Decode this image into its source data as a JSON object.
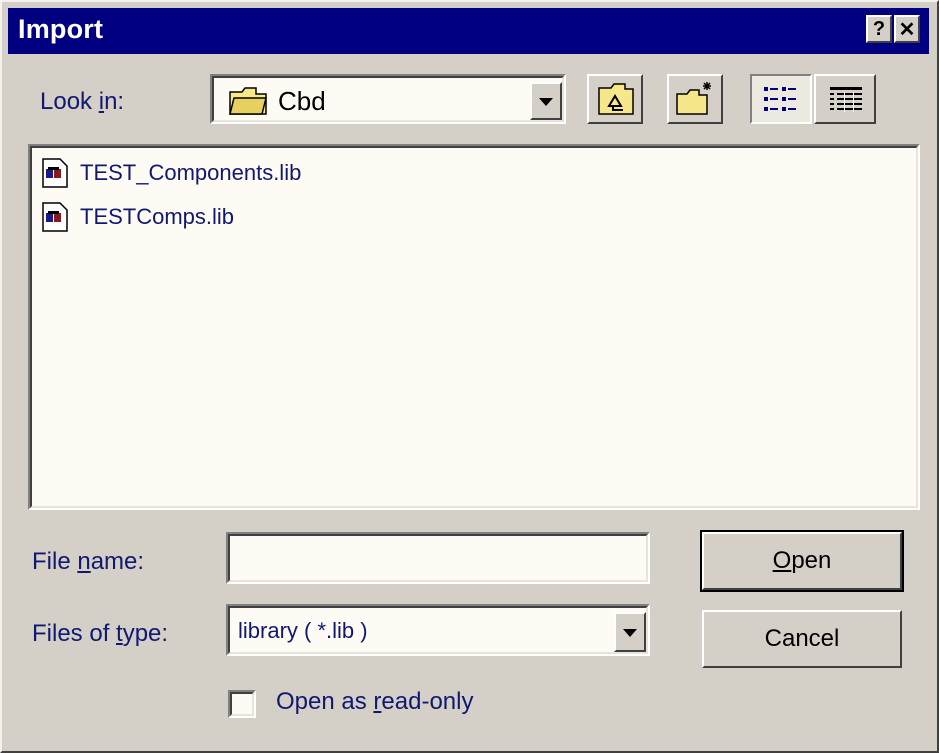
{
  "window": {
    "title": "Import",
    "help_label": "?",
    "close_label": "✕"
  },
  "look_in": {
    "label_prefix": "Look ",
    "label_underlined": "i",
    "label_suffix": "n:",
    "value": "Cbd"
  },
  "toolbar": {
    "up_folder_icon": "up-folder-icon",
    "new_folder_icon": "new-folder-icon",
    "list_view_icon": "list-view-icon",
    "details_view_icon": "details-view-icon"
  },
  "files": [
    {
      "name": "TEST_Components.lib"
    },
    {
      "name": "TESTComps.lib"
    }
  ],
  "file_name": {
    "label_prefix": "File ",
    "label_underlined": "n",
    "label_suffix": "ame:",
    "value": ""
  },
  "files_of_type": {
    "label_prefix": "Files of ",
    "label_underlined": "t",
    "label_suffix": "ype:",
    "value": "library ( *.lib )"
  },
  "buttons": {
    "open_underlined": "O",
    "open_rest": "pen",
    "cancel": "Cancel"
  },
  "read_only": {
    "label_prefix": "Open as ",
    "label_underlined": "r",
    "label_suffix": "ead-only",
    "checked": false
  },
  "colors": {
    "title_bar": "#000080",
    "face": "#d4d0c8",
    "field": "#fdfbf4",
    "label_text": "#101870"
  }
}
